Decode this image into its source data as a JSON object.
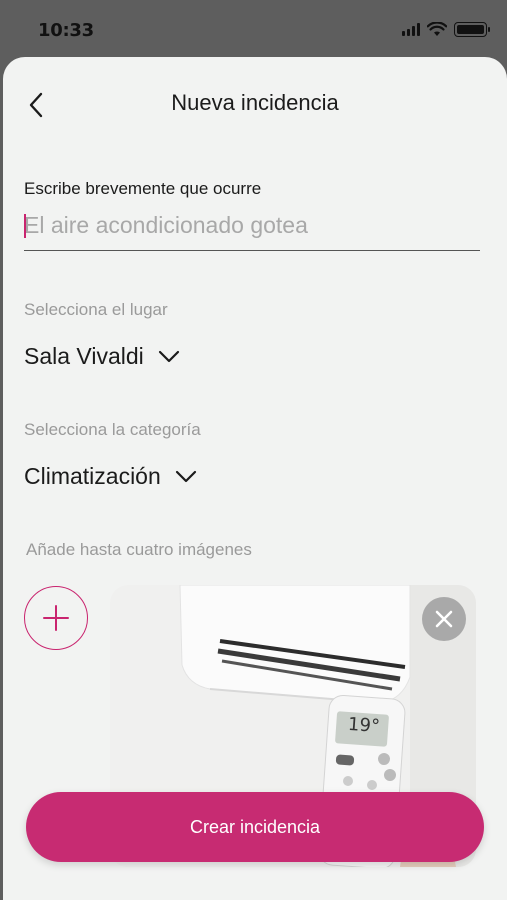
{
  "status_bar": {
    "time": "10:33",
    "icons": [
      "signal-icon",
      "wifi-icon",
      "battery-icon"
    ]
  },
  "header": {
    "title": "Nueva incidencia",
    "back_icon": "chevron-left-icon"
  },
  "description": {
    "label": "Escribe brevemente que ocurre",
    "placeholder": "El aire acondicionado gotea",
    "value": ""
  },
  "location": {
    "label": "Selecciona el lugar",
    "selected": "Sala Vivaldi"
  },
  "category": {
    "label": "Selecciona la categoría",
    "selected": "Climatización"
  },
  "images": {
    "label": "Añade hasta cuatro imágenes",
    "add_icon": "plus-icon",
    "remove_icon": "close-icon",
    "remote_display": "19°"
  },
  "submit": {
    "label": "Crear incidencia"
  },
  "colors": {
    "accent": "#c72b72",
    "background": "#f2f3f2",
    "overlay": "#5e5e5e"
  }
}
